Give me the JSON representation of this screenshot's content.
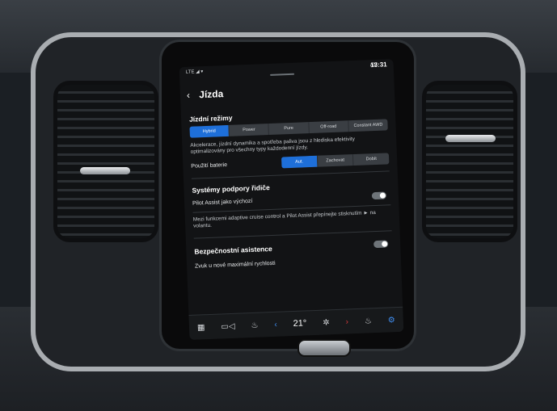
{
  "status_bar": {
    "left": "LTE ◢ ▾",
    "right": "AV",
    "time": "13:31"
  },
  "header": {
    "back_icon": "chevron-left-icon",
    "title": "Jízda"
  },
  "driving_modes": {
    "title": "Jízdní režimy",
    "options": [
      "Hybrid",
      "Power",
      "Pure",
      "Off-road",
      "Constant AWD"
    ],
    "selected": "Hybrid",
    "description": "Akcelerace, jízdní dynamika a spotřeba paliva jsou z hlediska efektivity optimalizovány pro všechny typy každodenní jízdy."
  },
  "battery": {
    "label": "Použití baterie",
    "options": [
      "Aut.",
      "Zachovat",
      "Dobít"
    ],
    "selected": "Aut."
  },
  "driver_support": {
    "title": "Systémy podpory řidiče",
    "pilot_assist_label": "Pilot Assist jako výchozí",
    "pilot_assist_on": false,
    "description": "Mezi funkcemi adaptive cruise control a Pilot Assist přepínejte stisknutím ► na volantu."
  },
  "safety": {
    "title": "Bezpečnostní asistence",
    "speed_sound_label": "Zvuk u nové maximální rychlosti",
    "speed_sound_on": false
  },
  "bottom_bar": {
    "apps_icon": "grid-icon",
    "camera_icon": "camera-icon",
    "seat_icon": "seat-icon",
    "temp_value": "21°",
    "temp_mode": "AUTO",
    "fan_icon": "fan-icon",
    "heated_seat_icon": "seat-heat-icon",
    "settings_icon": "gear-icon"
  },
  "colors": {
    "accent": "#1e6fd9",
    "screen_bg": "#121315"
  }
}
